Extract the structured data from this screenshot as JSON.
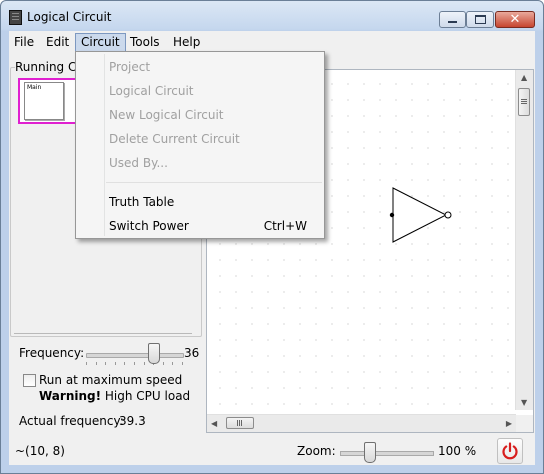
{
  "window": {
    "title": "Logical Circuit"
  },
  "menubar": {
    "items": [
      "File",
      "Edit",
      "Circuit",
      "Tools",
      "Help"
    ],
    "active": "Circuit"
  },
  "circuit_menu": {
    "items": [
      {
        "label": "Project",
        "enabled": false,
        "shortcut": ""
      },
      {
        "label": "Logical Circuit",
        "enabled": false,
        "shortcut": ""
      },
      {
        "label": "New Logical Circuit",
        "enabled": false,
        "shortcut": ""
      },
      {
        "label": "Delete Current Circuit",
        "enabled": false,
        "shortcut": ""
      },
      {
        "label": "Used By...",
        "enabled": false,
        "shortcut": ""
      },
      {
        "label": "Truth Table",
        "enabled": true,
        "shortcut": ""
      },
      {
        "label": "Switch Power",
        "enabled": true,
        "shortcut": "Ctrl+W"
      }
    ]
  },
  "left_panel": {
    "group_label": "Running Ci",
    "thumbnail_label": "Main",
    "thumbnail_name": "M",
    "frequency_label": "Frequency:",
    "frequency_value": "36",
    "frequency_slider_fraction": 0.7,
    "run_max_label": "Run at maximum speed",
    "run_max_checked": false,
    "warning_bold": "Warning!",
    "warning_text": " High CPU load",
    "actual_frequency_label": "Actual frequency:",
    "actual_frequency_value": "39.3"
  },
  "status": {
    "coords": "~(10, 8)",
    "zoom_label": "Zoom:",
    "zoom_value": "100 %",
    "zoom_slider_fraction": 0.3
  },
  "colors": {
    "selection": "#e020d0",
    "power": "#d81e1e"
  }
}
